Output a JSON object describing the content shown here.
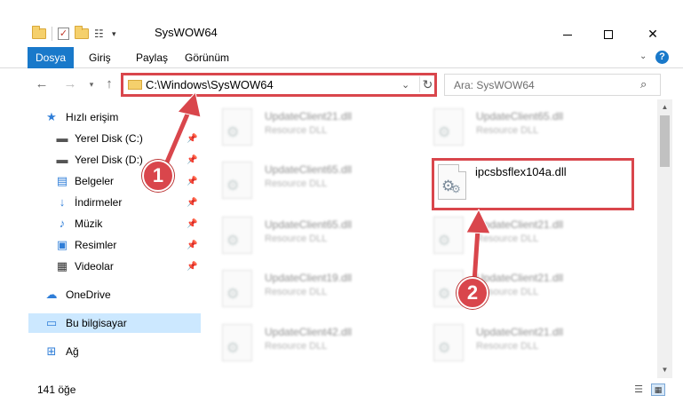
{
  "window": {
    "title": "SysWOW64",
    "minimize_glyph": "—",
    "close_glyph": "✕"
  },
  "ribbon": {
    "tabs": [
      "Dosya",
      "Giriş",
      "Paylaş",
      "Görünüm"
    ],
    "help_glyph": "?",
    "accent_color": "#1979ca"
  },
  "navigation": {
    "address": "C:\\Windows\\SysWOW64",
    "search_placeholder": "Ara: SysWOW64"
  },
  "sidebar": {
    "items": [
      {
        "label": "Hızlı erişim",
        "icon": "star-icon",
        "pinned": false
      },
      {
        "label": "Yerel Disk (C:)",
        "icon": "drive-icon",
        "pinned": true
      },
      {
        "label": "Yerel Disk (D:)",
        "icon": "drive-icon",
        "pinned": true
      },
      {
        "label": "Belgeler",
        "icon": "document-icon",
        "pinned": true
      },
      {
        "label": "İndirmeler",
        "icon": "download-icon",
        "pinned": true
      },
      {
        "label": "Müzik",
        "icon": "music-icon",
        "pinned": true
      },
      {
        "label": "Resimler",
        "icon": "pictures-icon",
        "pinned": true
      },
      {
        "label": "Videolar",
        "icon": "video-icon",
        "pinned": true
      },
      {
        "label": "OneDrive",
        "icon": "cloud-icon",
        "pinned": false
      },
      {
        "label": "Bu bilgisayar",
        "icon": "computer-icon",
        "pinned": false,
        "selected": true
      },
      {
        "label": "Ağ",
        "icon": "network-icon",
        "pinned": false
      }
    ]
  },
  "files": [
    {
      "name": "UpdateClient21.dll",
      "type": "Resource DLL"
    },
    {
      "name": "UpdateClient65.dll",
      "type": "Resource DLL"
    },
    {
      "name": "UpdateClient65.dll",
      "type": "Resource DLL"
    },
    {
      "name": "ipcsbsflex104a.dll",
      "type": ""
    },
    {
      "name": "UpdateClient65.dll",
      "type": "Resource DLL"
    },
    {
      "name": "UpdateClient21.dll",
      "type": "Resource DLL"
    },
    {
      "name": "UpdateClient19.dll",
      "type": "Resource DLL"
    },
    {
      "name": "UpdateClient21.dll",
      "type": "Resource DLL"
    },
    {
      "name": "UpdateClient42.dll",
      "type": "Resource DLL"
    },
    {
      "name": "UpdateClient21.dll",
      "type": "Resource DLL"
    }
  ],
  "status": {
    "item_count": "141 öğe"
  },
  "annotations": {
    "step1": "1",
    "step2": "2",
    "color": "#d9464c"
  }
}
